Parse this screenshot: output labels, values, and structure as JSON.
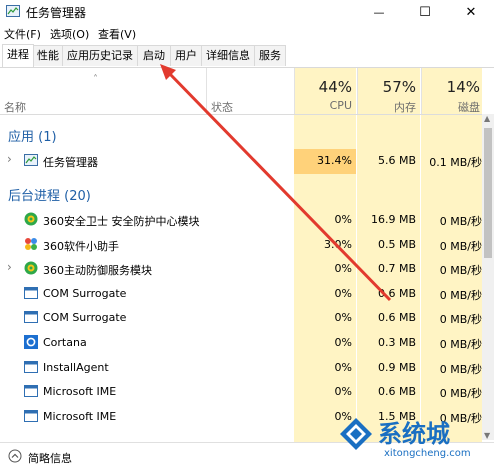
{
  "window": {
    "title": "任务管理器",
    "minimize_glyph": "—",
    "maximize_glyph": "☐",
    "close_glyph": "✕"
  },
  "menu": [
    "文件(F)",
    "选项(O)",
    "查看(V)"
  ],
  "tabs": [
    "进程",
    "性能",
    "应用历史记录",
    "启动",
    "用户",
    "详细信息",
    "服务"
  ],
  "active_tab": "进程",
  "header": {
    "name": "名称",
    "status": "状态",
    "cpu_pct": "44%",
    "cpu_label": "CPU",
    "mem_pct": "57%",
    "mem_label": "内存",
    "disk_pct": "14%",
    "disk_label": "磁盘"
  },
  "sections": {
    "apps": "应用 (1)",
    "background": "后台进程 (20)"
  },
  "apps": [
    {
      "name": "任务管理器",
      "cpu": "31.4%",
      "mem": "5.6 MB",
      "disk": "0.1 MB/秒",
      "icon": "task-manager-icon"
    }
  ],
  "background": [
    {
      "name": "360安全卫士 安全防护中心模块",
      "cpu": "0%",
      "mem": "16.9 MB",
      "disk": "0 MB/秒",
      "icon": "360-shield-icon"
    },
    {
      "name": "360软件小助手",
      "cpu": "3.0%",
      "mem": "0.5 MB",
      "disk": "0 MB/秒",
      "icon": "360-assistant-icon"
    },
    {
      "name": "360主动防御服务模块",
      "cpu": "0%",
      "mem": "0.7 MB",
      "disk": "0 MB/秒",
      "icon": "360-defense-icon"
    },
    {
      "name": "COM Surrogate",
      "cpu": "0%",
      "mem": "0.6 MB",
      "disk": "0 MB/秒",
      "icon": "window-icon"
    },
    {
      "name": "COM Surrogate",
      "cpu": "0%",
      "mem": "0.6 MB",
      "disk": "0 MB/秒",
      "icon": "window-icon"
    },
    {
      "name": "Cortana",
      "cpu": "0%",
      "mem": "0.3 MB",
      "disk": "0 MB/秒",
      "icon": "cortana-icon"
    },
    {
      "name": "InstallAgent",
      "cpu": "0%",
      "mem": "0.9 MB",
      "disk": "0 MB/秒",
      "icon": "window-icon"
    },
    {
      "name": "Microsoft IME",
      "cpu": "0%",
      "mem": "0.6 MB",
      "disk": "0 MB/秒",
      "icon": "window-icon"
    },
    {
      "name": "Microsoft IME",
      "cpu": "0%",
      "mem": "1.5 MB",
      "disk": "0 MB/秒",
      "icon": "window-icon"
    }
  ],
  "statusbar": {
    "label": "简略信息",
    "icon": "collapse-up-icon"
  },
  "watermark": {
    "brand": "系统城",
    "url": "xitongcheng.com"
  },
  "colors": {
    "heat": "#fff4c4",
    "heat_strong": "#ffd27a",
    "section": "#1f5fa6",
    "annotation_arrow": "#e23a2e"
  }
}
